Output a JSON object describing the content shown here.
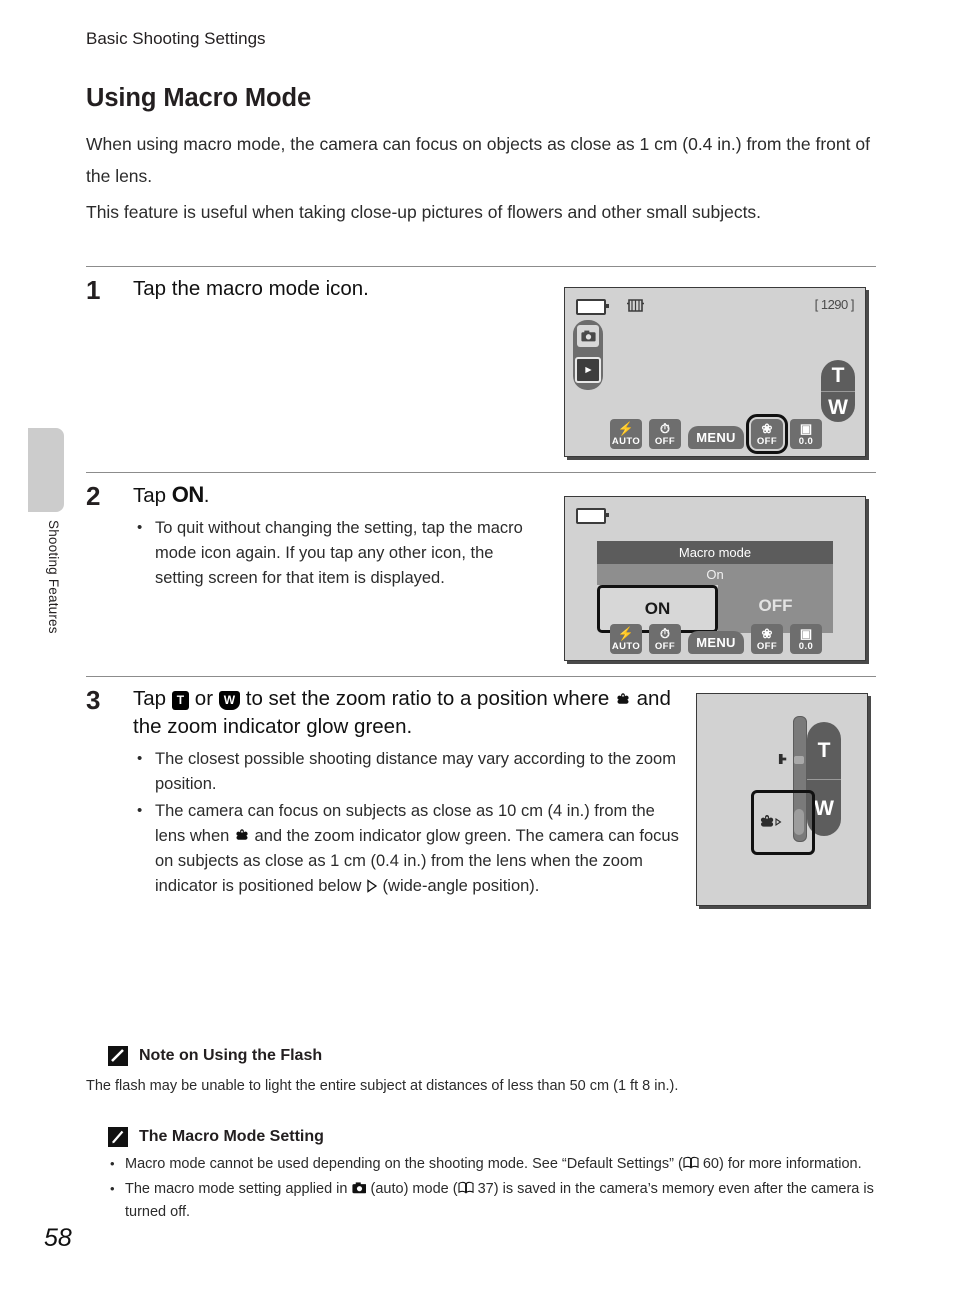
{
  "sidebar": {
    "tab_label": "Shooting Features"
  },
  "header": {
    "running_head": "Basic Shooting Settings",
    "title": "Using Macro Mode"
  },
  "intro": {
    "paragraph1": "When using macro mode, the camera can focus on objects as close as 1 cm (0.4 in.) from the front of the lens.",
    "paragraph2": "This feature is useful when taking close-up pictures of flowers and other small subjects."
  },
  "steps": [
    {
      "number": "1",
      "title": "Tap the macro mode icon.",
      "bullets": []
    },
    {
      "number": "2",
      "title_prefix": "Tap ",
      "title_glyph": "ON",
      "title_suffix": ".",
      "bullets": [
        "To quit without changing the setting, tap the macro mode icon again. If you tap any other icon, the setting screen for that item is displayed."
      ]
    },
    {
      "number": "3",
      "title_part1": "Tap ",
      "title_key_t": "T",
      "title_part2": " or ",
      "title_key_w": "W",
      "title_part3": " to set the zoom ratio to a position where ",
      "title_part4": " and the zoom indicator glow green.",
      "bullets": [
        "The closest possible shooting distance may vary according to the zoom position.",
        "The camera can focus on subjects as close as 10 cm (4 in.) from the lens when  and the zoom indicator glow green. The camera can focus on subjects as close as 1 cm (0.4 in.) from the lens when the zoom indicator is positioned below  (wide-angle position)."
      ],
      "bullet2_seg1": "The camera can focus on subjects as close as 10 cm (4 in.) from the lens when ",
      "bullet2_seg2": " and the zoom indicator glow green. The camera can focus on subjects as close as 1 cm (0.4 in.) from the lens when the zoom indicator is positioned below ",
      "bullet2_seg3": " (wide-angle position)."
    }
  ],
  "screen1": {
    "shots_remaining": "1290",
    "toolbar": {
      "flash_label": "AUTO",
      "selftimer_label": "OFF",
      "menu_label": "MENU",
      "macro_label": "OFF",
      "exposure_label": "0.0"
    }
  },
  "screen2": {
    "dialog_title": "Macro mode",
    "dialog_value": "On",
    "option_on": "ON",
    "option_off": "OFF",
    "toolbar": {
      "flash_label": "AUTO",
      "selftimer_label": "OFF",
      "menu_label": "MENU",
      "macro_label": "OFF",
      "exposure_label": "0.0"
    }
  },
  "screen3": {
    "zoom_tele_label": "T",
    "zoom_wide_label": "W"
  },
  "notes": [
    {
      "icon": "caution-icon",
      "title": "Note on Using the Flash",
      "text": "The flash may be unable to light the entire subject at distances of less than 50 cm (1 ft 8 in.)."
    },
    {
      "icon": "pencil-note-icon",
      "title": "The Macro Mode Setting",
      "bullet1_seg1": "Macro mode cannot be used depending on the shooting mode. See “Default Settings” (",
      "bullet1_page": " 60",
      "bullet1_seg2": ") for more information.",
      "bullet2_seg1": "The macro mode setting applied in ",
      "bullet2_seg2": " (auto) mode (",
      "bullet2_page": " 37",
      "bullet2_seg3": ") is saved in the camera’s memory even after the camera is turned off."
    }
  ],
  "footer": {
    "page_number": "58"
  },
  "colors": {
    "lcd_background": "#d2d2d2",
    "toolbar_button": "#6e6e6e",
    "dialog_header": "#5c5c5c",
    "tab_gray": "#cccccc"
  }
}
